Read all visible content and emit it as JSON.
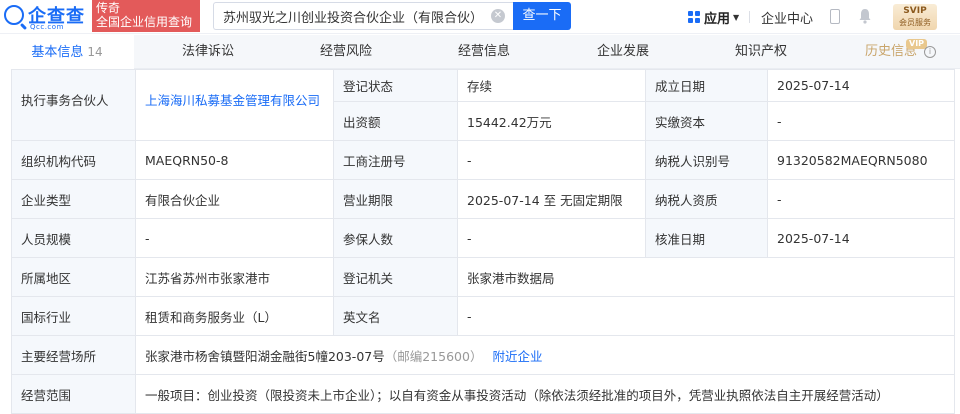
{
  "header": {
    "logo_text": "企查查",
    "logo_sub": "Qcc.com",
    "promo_line1": "传奇",
    "promo_line2": "全国企业信用查询",
    "search_value": "苏州驭光之川创业投资合伙企业（有限合伙）",
    "search_button": "查一下",
    "app_menu": "应用",
    "center_link": "企业中心",
    "vip_top": "SVIP",
    "vip_bottom": "会员服务"
  },
  "tabs": [
    {
      "label": "基本信息",
      "count": "14"
    },
    {
      "label": "法律诉讼"
    },
    {
      "label": "经营风险"
    },
    {
      "label": "经营信息"
    },
    {
      "label": "企业发展"
    },
    {
      "label": "知识产权"
    },
    {
      "label": "历史信息"
    }
  ],
  "tab_vip_badge": "VIP",
  "basic_info": {
    "partner_label": "执行事务合伙人",
    "partner_value": "上海海川私募基金管理有限公司",
    "reg_status_label": "登记状态",
    "reg_status_value": "存续",
    "est_date_label": "成立日期",
    "est_date_value": "2025-07-14",
    "capital_label": "出资额",
    "capital_value": "15442.42万元",
    "paid_capital_label": "实缴资本",
    "paid_capital_value": "-",
    "org_code_label": "组织机构代码",
    "org_code_value": "MAEQRN50-8",
    "biz_reg_no_label": "工商注册号",
    "biz_reg_no_value": "-",
    "taxpayer_id_label": "纳税人识别号",
    "taxpayer_id_value": "91320582MAEQRN5080",
    "type_label": "企业类型",
    "type_value": "有限合伙企业",
    "term_label": "营业期限",
    "term_value": "2025-07-14 至 无固定期限",
    "taxpayer_qual_label": "纳税人资质",
    "taxpayer_qual_value": "-",
    "staff_label": "人员规模",
    "staff_value": "-",
    "insured_label": "参保人数",
    "insured_value": "-",
    "approve_label": "核准日期",
    "approve_value": "2025-07-14",
    "region_label": "所属地区",
    "region_value": "江苏省苏州市张家港市",
    "authority_label": "登记机关",
    "authority_value": "张家港市数据局",
    "industry_label": "国标行业",
    "industry_value": "租赁和商务服务业（L）",
    "english_label": "英文名",
    "english_value": "-",
    "address_label": "主要经营场所",
    "address_value": "张家港市杨舍镇暨阳湖金融街5幢203-07号",
    "postcode": "（邮编215600）",
    "nearby": "附近企业",
    "scope_label": "经营范围",
    "scope_value": "一般项目：创业投资（限投资未上市企业）；以自有资金从事投资活动（除依法须经批准的项目外，凭营业执照依法自主开展经营活动）"
  }
}
